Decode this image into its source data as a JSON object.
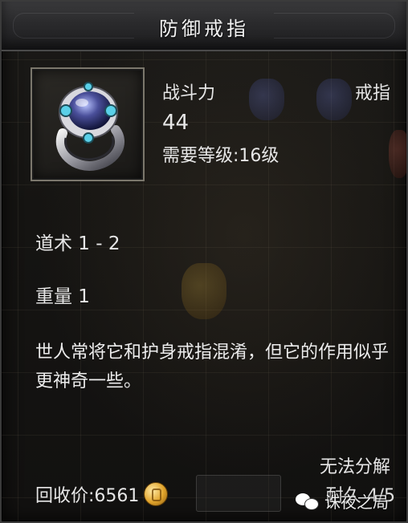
{
  "window": {
    "title": "防御戒指"
  },
  "item": {
    "icon": "ring-icon",
    "combat_label": "战斗力",
    "type_label": "戒指",
    "combat_value": "44",
    "required_level": "需要等级:16级",
    "stats": [
      "道术 1 - 2",
      "重量 1"
    ],
    "description": "世人常将它和护身戒指混淆，但它的作用似乎更神奇一些。",
    "cannot_decompose": "无法分解",
    "recycle_price": "回收价:6561",
    "currency_icon": "gold-coin-icon",
    "durability": "耐久 4/5"
  },
  "watermark": {
    "text": "诛夜之局",
    "icon": "wechat-icon"
  },
  "colors": {
    "text": "#e6e6e6",
    "frame": "#7b776c",
    "background": "#151412"
  }
}
